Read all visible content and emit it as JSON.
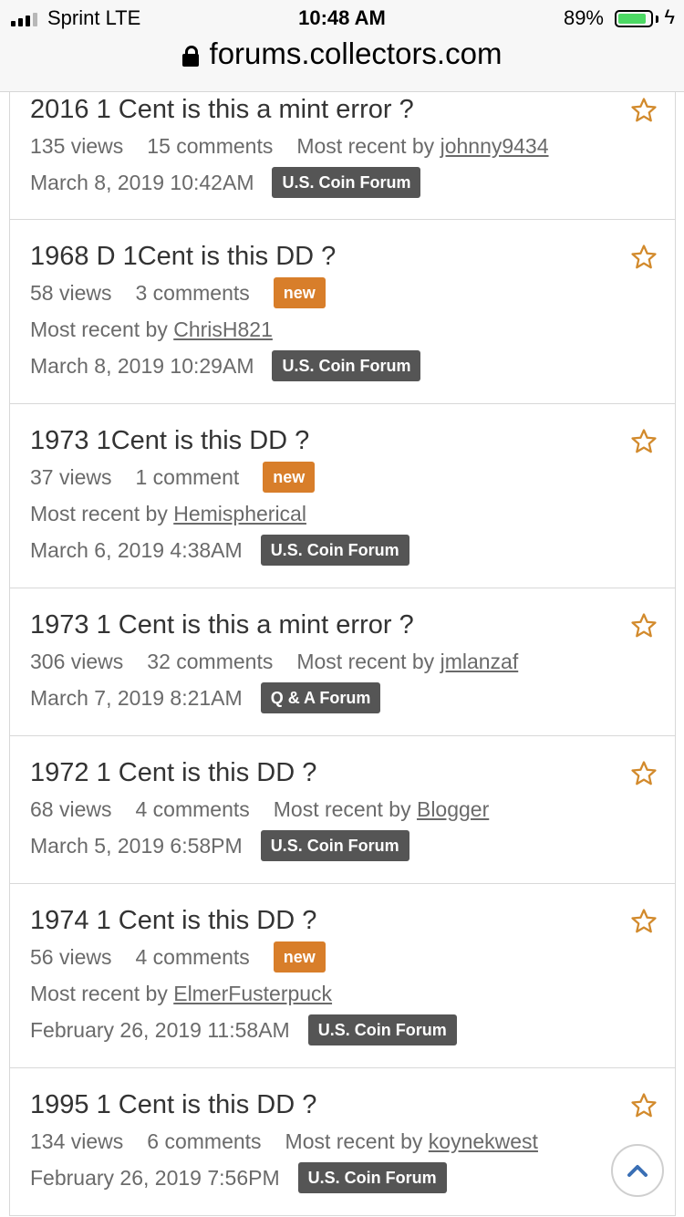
{
  "status_bar": {
    "carrier": "Sprint  LTE",
    "time": "10:48 AM",
    "battery": "89%",
    "battery_level": 0.89
  },
  "browser": {
    "url": "forums.collectors.com"
  },
  "threads": [
    {
      "title": "2016 1 Cent is this a mint error ?",
      "views": "135 views",
      "comments": "15 comments",
      "recent_prefix": "Most recent by",
      "recent_user": "johnny9434",
      "date": "March 8, 2019 10:42AM",
      "category": "U.S. Coin Forum"
    },
    {
      "title": "1968 D 1Cent is this DD ?",
      "views": "58 views",
      "comments": "3 comments",
      "badge": "new",
      "recent_prefix": "Most recent by",
      "recent_user": "ChrisH821",
      "date": "March 8, 2019 10:29AM",
      "category": "U.S. Coin Forum"
    },
    {
      "title": "1973 1Cent is this DD ?",
      "views": "37 views",
      "comments": "1 comment",
      "badge": "new",
      "recent_prefix": "Most recent by",
      "recent_user": "Hemispherical",
      "date": "March 6, 2019 4:38AM",
      "category": "U.S. Coin Forum"
    },
    {
      "title": "1973 1 Cent is this a mint error ?",
      "views": "306 views",
      "comments": "32 comments",
      "recent_prefix": "Most recent by",
      "recent_user": "jmlanzaf",
      "date": "March 7, 2019 8:21AM",
      "category": "Q & A Forum"
    },
    {
      "title": "1972 1 Cent is this DD ?",
      "views": "68 views",
      "comments": "4 comments",
      "recent_prefix": "Most recent by",
      "recent_user": "Blogger",
      "date": "March 5, 2019 6:58PM",
      "category": "U.S. Coin Forum"
    },
    {
      "title": "1974 1 Cent is this DD ?",
      "views": "56 views",
      "comments": "4 comments",
      "badge": "new",
      "recent_prefix": "Most recent by",
      "recent_user": "ElmerFusterpuck",
      "date": "February 26, 2019 11:58AM",
      "category": "U.S. Coin Forum"
    },
    {
      "title": "1995 1 Cent is this DD ?",
      "views": "134 views",
      "comments": "6 comments",
      "recent_prefix": "Most recent by",
      "recent_user": "koynekwest",
      "date": "February 26, 2019 7:56PM",
      "category": "U.S. Coin Forum"
    }
  ],
  "colors": {
    "new_badge": "#d87e2a",
    "category_badge": "#555555",
    "star": "#d28a2c",
    "scroll_top_arrow": "#3a6fb5"
  },
  "icons": {
    "bookmark": "star-outline-icon",
    "scroll_top": "chevron-up-icon",
    "secure": "lock-icon"
  }
}
